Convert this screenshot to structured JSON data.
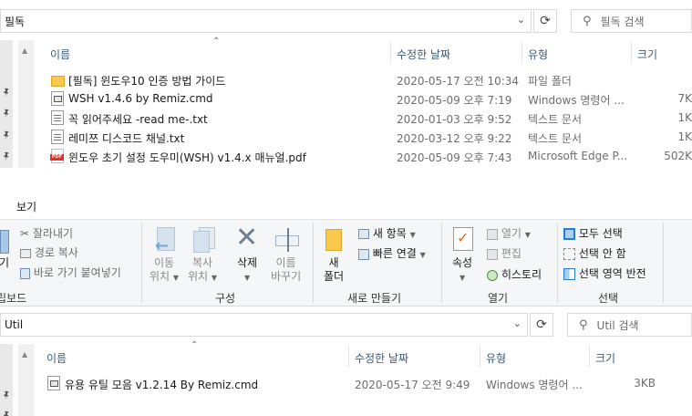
{
  "top_window": {
    "address": "필독",
    "search_placeholder": "필독 검색",
    "columns": [
      "이름",
      "수정한 날짜",
      "유형",
      "크기"
    ],
    "files": [
      {
        "name": "[필독] 윈도우10 인증 방법 가이드",
        "date": "2020-05-17 오전 10:34",
        "type": "파일 폴더",
        "size": "",
        "icon": "folder-icon"
      },
      {
        "name": "WSH v1.4.6 by Remiz.cmd",
        "date": "2020-05-09 오후 7:19",
        "type": "Windows 명령어 ...",
        "size": "7K",
        "icon": "cmd-file-icon"
      },
      {
        "name": "꼭 읽어주세요 -read me-.txt",
        "date": "2020-01-03 오후 9:52",
        "type": "텍스트 문서",
        "size": "1K",
        "icon": "text-file-icon"
      },
      {
        "name": "레미쯔 디스코드 채널.txt",
        "date": "2020-03-12 오후 9:22",
        "type": "텍스트 문서",
        "size": "1K",
        "icon": "text-file-icon"
      },
      {
        "name": "윈도우 초기 설정 도우미(WSH) v1.4.x 매뉴얼.pdf",
        "date": "2020-05-09 오후 7:43",
        "type": "Microsoft Edge P...",
        "size": "502K",
        "icon": "pdf-file-icon"
      }
    ]
  },
  "ribbon": {
    "tab": "보기",
    "clipboard": {
      "cut": "잘라내기",
      "copy_path": "경로 복사",
      "paste_shortcut": "바로 가기 붙여넣기",
      "paste_partial": "넣기",
      "group_label": "립보드"
    },
    "organize": {
      "move_to_line1": "이동",
      "move_to_line2": "위치",
      "copy_to_line1": "복사",
      "copy_to_line2": "위치",
      "delete": "삭제",
      "rename_line1": "이름",
      "rename_line2": "바꾸기",
      "group_label": "구성"
    },
    "new": {
      "new_folder_line1": "새",
      "new_folder_line2": "폴더",
      "new_item": "새 항목",
      "easy_access": "빠른 연결",
      "group_label": "새로 만들기"
    },
    "open": {
      "properties": "속성",
      "open": "열기",
      "edit": "편집",
      "history": "히스토리",
      "group_label": "열기"
    },
    "select": {
      "select_all": "모두 선택",
      "select_none": "선택 안 함",
      "invert": "선택 영역 반전",
      "group_label": "선택"
    }
  },
  "bottom_window": {
    "address": "Util",
    "search_placeholder": "Util 검색",
    "columns": [
      "이름",
      "수정한 날짜",
      "유형",
      "크기"
    ],
    "files": [
      {
        "name": "유용 유틸 모음 v1.2.14 By Remiz.cmd",
        "date": "2020-05-17 오전 9:49",
        "type": "Windows 명령어 ...",
        "size": "3KB",
        "icon": "cmd-file-icon"
      }
    ]
  },
  "colors": {
    "folder": "#f8c94a",
    "pdf": "#d9342b",
    "accent": "#0f6fc6",
    "header_text": "#3c5a7a"
  }
}
